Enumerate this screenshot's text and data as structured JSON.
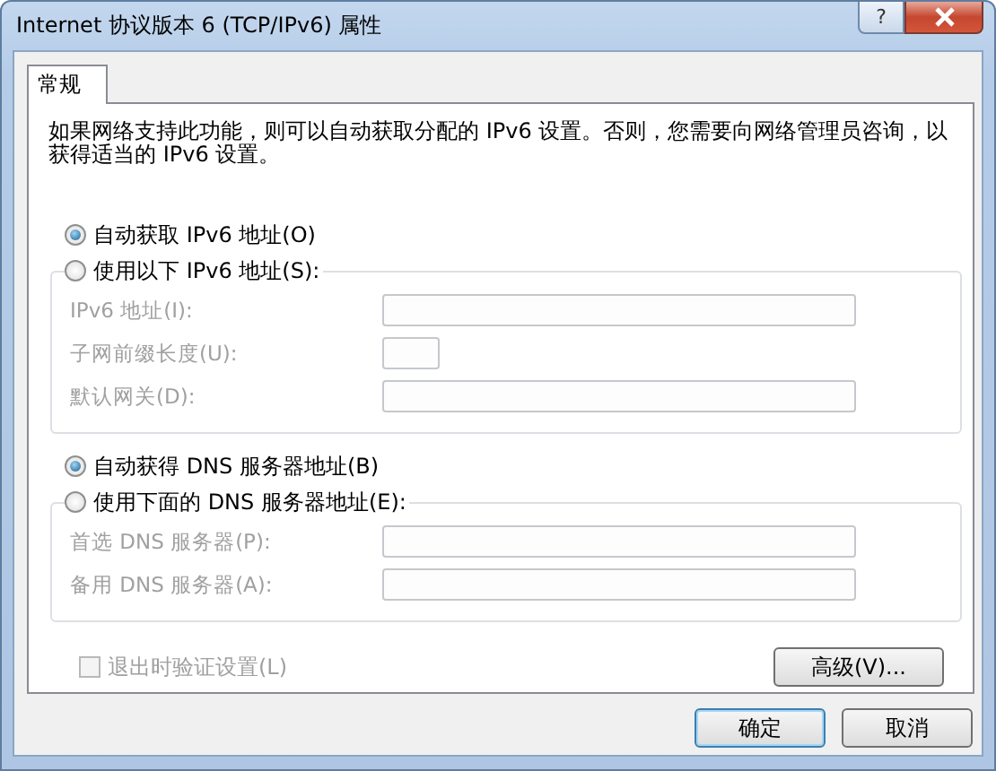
{
  "window": {
    "title": "Internet 协议版本 6 (TCP/IPv6) 属性",
    "help_button": "?"
  },
  "tabs": [
    {
      "label": "常规",
      "selected": true
    }
  ],
  "description": "如果网络支持此功能，则可以自动获取分配的 IPv6 设置。否则，您需要向网络管理员咨询，以获得适当的 IPv6 设置。",
  "sections": [
    {
      "radios": [
        {
          "label": "自动获取 IPv6 地址(O)",
          "selected": true
        },
        {
          "label": "使用以下 IPv6 地址(S):",
          "selected": false
        }
      ],
      "fields": [
        {
          "label": "IPv6 地址(I):",
          "kind": "address",
          "disabled": true
        },
        {
          "label": "子网前缀长度(U):",
          "kind": "prefix",
          "disabled": true
        },
        {
          "label": "默认网关(D):",
          "kind": "address",
          "disabled": true
        }
      ]
    },
    {
      "radios": [
        {
          "label": "自动获得 DNS 服务器地址(B)",
          "selected": true
        },
        {
          "label": "使用下面的 DNS 服务器地址(E):",
          "selected": false
        }
      ],
      "fields": [
        {
          "label": "首选 DNS 服务器(P):",
          "kind": "address",
          "disabled": true
        },
        {
          "label": "备用 DNS 服务器(A):",
          "kind": "address",
          "disabled": true
        }
      ]
    }
  ],
  "validate_checkbox": {
    "label": "退出时验证设置(L)",
    "checked": false,
    "disabled": true
  },
  "advanced_button": "高级(V)...",
  "buttons": [
    {
      "label": "确定",
      "default": true
    },
    {
      "label": "取消",
      "default": false
    }
  ]
}
